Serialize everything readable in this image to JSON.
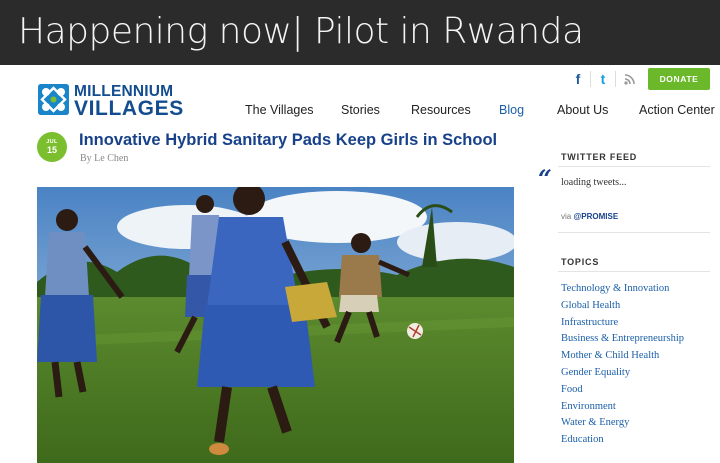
{
  "slide": {
    "title": "Happening now| Pilot in Rwanda"
  },
  "site": {
    "logo": {
      "line1": "MILLENNIUM",
      "line2": "VILLAGES"
    },
    "social": {
      "facebook": "f",
      "twitter": "t",
      "rss": "rss"
    },
    "donate_label": "DONATE",
    "nav": [
      "The Villages",
      "Stories",
      "Resources",
      "Blog",
      "About Us",
      "Action Center"
    ],
    "active_nav": "Blog"
  },
  "post": {
    "date": {
      "month": "JUL",
      "day": "15"
    },
    "title": "Innovative Hybrid Sanitary Pads Keep Girls in School",
    "byline": "By Le Chen",
    "image": {
      "subject": "girls in blue uniforms playing soccer on a grass field"
    }
  },
  "sidebar": {
    "twitter_feed": {
      "heading": "TWITTER FEED",
      "status": "loading tweets...",
      "via_prefix": "via",
      "via_handle": "@PROMISE"
    },
    "topics": {
      "heading": "TOPICS",
      "items": [
        "Technology & Innovation",
        "Global Health",
        "Infrastructure",
        "Business & Entrepreneurship",
        "Mother & Child Health",
        "Gender Equality",
        "Food",
        "Environment",
        "Water & Energy",
        "Education"
      ]
    }
  },
  "colors": {
    "banner": "#2b2b2b",
    "brand_blue": "#144d8f",
    "link_blue": "#1b5fa8",
    "donate_green": "#6bb82a",
    "date_green": "#7bbf2e"
  }
}
